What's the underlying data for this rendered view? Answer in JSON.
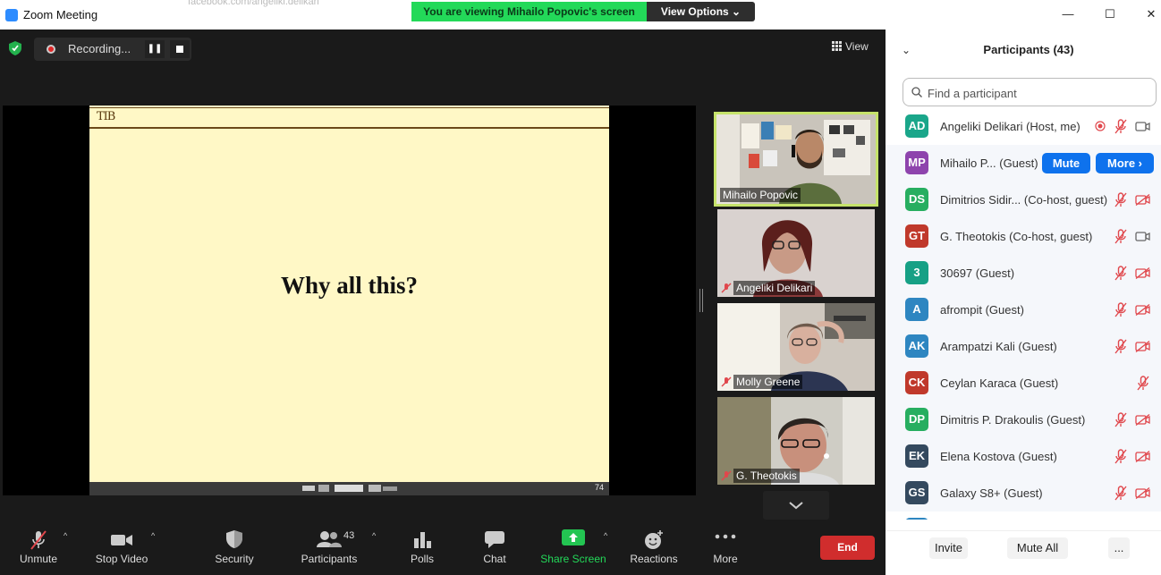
{
  "window": {
    "title": "Zoom Meeting",
    "background_url": "facebook.com/angeliki.delikari",
    "minimize_glyph": "—",
    "maximize_glyph": "☐",
    "close_glyph": "✕"
  },
  "banner": {
    "viewing_text": "You are viewing Mihailo Popovic's screen",
    "view_options": "View Options ⌄"
  },
  "meeting": {
    "recording_label": "Recording...",
    "pause_glyph": "❚❚",
    "view_label": "View",
    "view_icon": "grid-icon"
  },
  "slide": {
    "logo_text": "TIB",
    "title": "Why all this?",
    "page_number": "74"
  },
  "tiles": [
    {
      "name": "Mihailo Popovic",
      "active": true,
      "muted": false
    },
    {
      "name": "Angeliki Delikari",
      "active": false,
      "muted": true
    },
    {
      "name": "Molly Greene",
      "active": false,
      "muted": true
    },
    {
      "name": "G. Theotokis",
      "active": false,
      "muted": true
    }
  ],
  "toolbar": {
    "unmute": "Unmute",
    "stop_video": "Stop Video",
    "security": "Security",
    "participants": "Participants",
    "participants_count": "43",
    "polls": "Polls",
    "chat": "Chat",
    "share_screen": "Share Screen",
    "reactions": "Reactions",
    "more": "More",
    "end": "End"
  },
  "panel": {
    "title": "Participants (43)",
    "search_placeholder": "Find a participant",
    "participants": [
      {
        "initials": "AD",
        "color": "#1aa68a",
        "name": "Angeliki Delikari (Host, me)",
        "recording": true,
        "mic": "muted",
        "cam": "on",
        "highlight": false
      },
      {
        "initials": "MP",
        "color": "#8e44ad",
        "name": "Mihailo P... (Guest)",
        "hover": true,
        "highlight": true
      },
      {
        "initials": "DS",
        "color": "#27ae60",
        "name": "Dimitrios Sidir...  (Co-host, guest)",
        "mic": "muted",
        "cam": "off",
        "highlight": true
      },
      {
        "initials": "GT",
        "color": "#c0392b",
        "name": "G. Theotokis (Co-host, guest)",
        "mic": "muted",
        "cam": "on",
        "highlight": true
      },
      {
        "initials": "3",
        "color": "#16a085",
        "name": "30697 (Guest)",
        "mic": "muted",
        "cam": "off",
        "highlight": true
      },
      {
        "initials": "A",
        "color": "#2e86c1",
        "name": "afrompit (Guest)",
        "mic": "muted",
        "cam": "off",
        "highlight": true
      },
      {
        "initials": "AK",
        "color": "#2e86c1",
        "name": "Arampatzi Kali (Guest)",
        "mic": "muted",
        "cam": "off",
        "highlight": true
      },
      {
        "initials": "CK",
        "color": "#c0392b",
        "name": "Ceylan Karaca (Guest)",
        "mic": "muted",
        "cam": "none",
        "highlight": true
      },
      {
        "initials": "DP",
        "color": "#27ae60",
        "name": "Dimitris P. Drakoulis (Guest)",
        "mic": "muted",
        "cam": "off",
        "highlight": true
      },
      {
        "initials": "EK",
        "color": "#34495e",
        "name": "Elena Kostova (Guest)",
        "mic": "muted",
        "cam": "off",
        "highlight": true
      },
      {
        "initials": "GS",
        "color": "#34495e",
        "name": "Galaxy S8+ (Guest)",
        "mic": "muted",
        "cam": "off",
        "highlight": true
      }
    ],
    "hover_actions": {
      "mute": "Mute",
      "more": "More ›"
    },
    "footer": {
      "invite": "Invite",
      "mute_all": "Mute All",
      "more": "..."
    },
    "collapse_glyph": "⌄"
  },
  "colors": {
    "accent_green": "#23d959",
    "zoom_blue": "#0e72ed",
    "end_red": "#d02d2d",
    "muted_red": "#e0474c",
    "active_speaker_border": "#c6e36b"
  }
}
